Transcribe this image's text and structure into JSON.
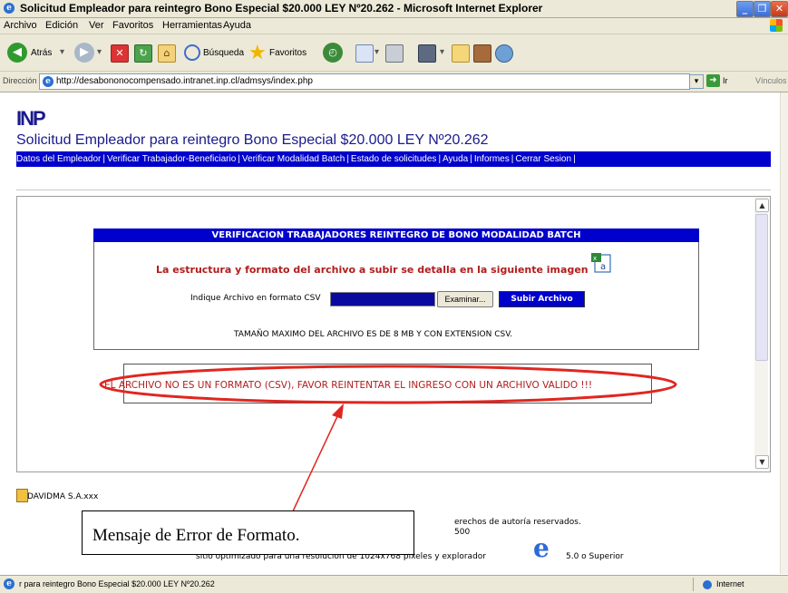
{
  "window": {
    "title": "Solicitud Empleador para reintegro Bono Especial $20.000 LEY Nº20.262 - Microsoft Internet Explorer"
  },
  "menu": [
    "Archivo",
    "Edición",
    "Ver",
    "Favoritos",
    "Herramientas",
    "Ayuda"
  ],
  "toolbar": {
    "back_label": "Atrás",
    "search_label": "Búsqueda",
    "favorites_label": "Favoritos"
  },
  "address": {
    "label": "Dirección",
    "url": "http://desabononocompensado.intranet.inp.cl/admsys/index.php",
    "go_label": "Ir",
    "links_label": "Vínculos"
  },
  "page": {
    "logo": "INP",
    "title": "Solicitud Empleador para reintegro Bono Especial $20.000 LEY Nº20.262",
    "nav": [
      "Datos del Empleador",
      "Verificar Trabajador-Beneficiario",
      "Verificar Modalidad Batch",
      "Estado de solicitudes",
      "Ayuda",
      "Informes",
      "Cerrar Sesion"
    ],
    "nav_separator": "|"
  },
  "batch": {
    "heading": "VERIFICACION TRABAJADORES REINTEGRO DE BONO MODALIDAD BATCH",
    "subheading": "La estructura y formato del archivo a subir se detalla en la siguiente imagen",
    "file_label": "Indique Archivo en formato CSV",
    "browse_label": "Examinar...",
    "upload_label": "Subir Archivo",
    "max_size_note": "TAMAÑO MAXIMO DEL ARCHIVO ES DE 8 MB Y CON EXTENSION CSV."
  },
  "error": {
    "message": "EL ARCHIVO NO ES UN FORMATO (CSV), FAVOR REINTENTAR EL INGRESO CON UN ARCHIVO VALIDO !!!"
  },
  "footer": {
    "company": "DAVIDMA S.A.xxx",
    "rights": "erechos de autoría reservados.",
    "phone": "500",
    "optimized": "sitio optimizado para una resolucion de 1024x768 pixeles y explorador",
    "version": "5.0 o Superior"
  },
  "callout": {
    "text": "Mensaje de Error de Formato."
  },
  "status": {
    "text": "r para reintegro Bono Especial $20.000 LEY Nº20.262",
    "zone": "Internet"
  },
  "colors": {
    "nav_blue": "#0000cc",
    "error_red": "#b21c1c",
    "annotation_red": "#e0261f"
  }
}
